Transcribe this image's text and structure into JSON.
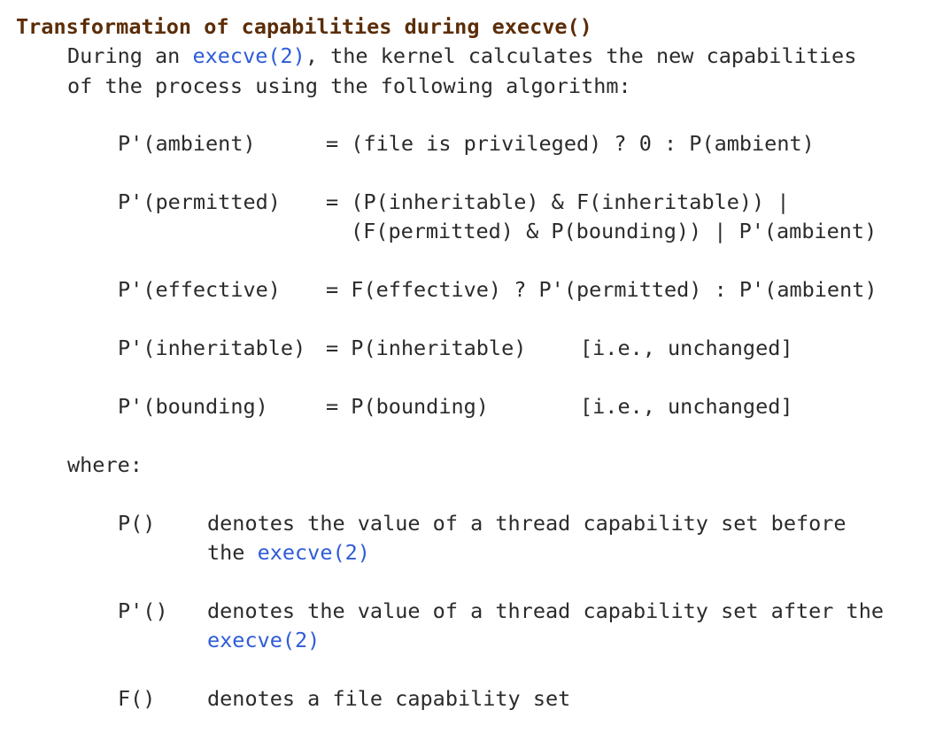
{
  "section": {
    "heading": "Transformation of capabilities during execve()",
    "intro": {
      "line1_before": "During an ",
      "line1_link": "execve(2)",
      "line1_after": ", the kernel calculates the new capabilities",
      "line2": "of the process using the following algorithm:"
    },
    "formulas": [
      {
        "lhs": "P'(ambient)",
        "rhs": "= (file is privileged) ? 0 : P(ambient)"
      },
      {
        "lhs": "P'(permitted)",
        "rhs": "= (P(inheritable) & F(inheritable)) |",
        "rhs_cont": "(F(permitted) & P(bounding)) | P'(ambient)"
      },
      {
        "lhs": "P'(effective)",
        "rhs": "= F(effective) ? P'(permitted) : P'(ambient)"
      },
      {
        "lhs": "P'(inheritable)",
        "rhs": "= P(inheritable)",
        "note": "[i.e., unchanged]"
      },
      {
        "lhs": "P'(bounding)",
        "rhs": "= P(bounding)",
        "note": "[i.e., unchanged]"
      }
    ],
    "where_label": "where:",
    "definitions": [
      {
        "term": "P()",
        "desc_line1": "denotes the value of a thread capability set before",
        "desc_line2_before": "the ",
        "desc_line2_link": "execve(2)"
      },
      {
        "term": "P'()",
        "desc_line1": "denotes the value of a thread capability set after the",
        "desc_line2_before": "",
        "desc_line2_link": "execve(2)"
      },
      {
        "term": "F()",
        "desc_line1": "denotes a file capability set"
      }
    ]
  }
}
